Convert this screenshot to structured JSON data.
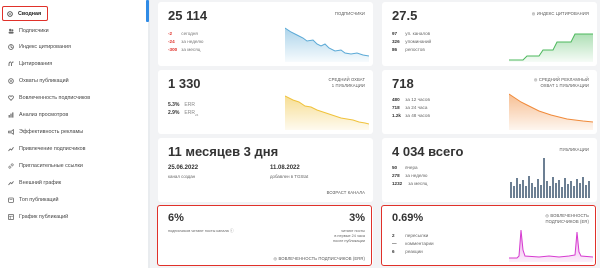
{
  "sidebar": {
    "items": [
      {
        "label": "Сводная",
        "icon": "dashboard-icon"
      },
      {
        "label": "Подписчики",
        "icon": "subscribers-icon"
      },
      {
        "label": "Индекс цитирования",
        "icon": "citation-index-icon"
      },
      {
        "label": "Цитирования",
        "icon": "quotes-icon"
      },
      {
        "label": "Охваты публикаций",
        "icon": "reach-icon"
      },
      {
        "label": "Вовлеченность подписчиков",
        "icon": "engagement-icon"
      },
      {
        "label": "Анализ просмотров",
        "icon": "views-icon"
      },
      {
        "label": "Эффективность рекламы",
        "icon": "ads-icon"
      },
      {
        "label": "Привлечение подписчиков",
        "icon": "growth-icon"
      },
      {
        "label": "Пригласительные ссылки",
        "icon": "link-icon"
      },
      {
        "label": "Внешний график",
        "icon": "external-chart-icon"
      },
      {
        "label": "Топ публикаций",
        "icon": "top-posts-icon"
      },
      {
        "label": "График публикаций",
        "icon": "schedule-icon"
      }
    ]
  },
  "subscribers": {
    "value": "25 114",
    "label": "ПОДПИСЧИКИ",
    "rows": [
      {
        "num": "-2",
        "text": "сегодня"
      },
      {
        "num": "-24",
        "text": "за неделю"
      },
      {
        "num": "-300",
        "text": "за месяц"
      }
    ],
    "color": "#5aa9d6"
  },
  "citation": {
    "value": "27.5",
    "label": "ИНДЕКС ЦИТИРОВАНИЯ",
    "rows": [
      {
        "num": "97",
        "text": "уп. каналов"
      },
      {
        "num": "326",
        "text": "упоминаний"
      },
      {
        "num": "86",
        "text": "репостов"
      }
    ],
    "color": "#4cb85c"
  },
  "reach": {
    "value": "1 330",
    "label_line1": "СРЕДНИЙ ОХВАТ",
    "label_line2": "1 ПУБЛИКАЦИИ",
    "err": "5.3%",
    "err_label": "ERR",
    "err24": "2.9%",
    "err24_label": "ERR",
    "err24_sub": "24",
    "color": "#f0c23b"
  },
  "ad_reach": {
    "value": "718",
    "label_line1": "СРЕДНИЙ РЕКЛАМНЫЙ",
    "label_line2": "ОХВАТ 1 ПУБЛИКАЦИИ",
    "rows": [
      {
        "num": "480",
        "text": "за 12 часов"
      },
      {
        "num": "718",
        "text": "за 24 часа"
      },
      {
        "num": "1.2k",
        "text": "за 48 часов"
      }
    ],
    "color": "#f08a3a"
  },
  "age": {
    "value": "11 месяцев 3 дня",
    "created_date": "25.06.2022",
    "created_label": "канал создан",
    "added_date": "11.08.2022",
    "added_label": "добавлен в TGStat",
    "label": "ВОЗРАСТ КАНАЛА"
  },
  "publications": {
    "value": "4 034 всего",
    "label": "ПУБЛИКАЦИИ",
    "rows": [
      {
        "num": "50",
        "text": "вчера"
      },
      {
        "num": "278",
        "text": "за неделю"
      },
      {
        "num": "1232",
        "text": "за месяц"
      }
    ],
    "color": "#6c7f93"
  },
  "read": {
    "left_value": "6%",
    "left_label": "подписчиков читают посты канала",
    "right_value": "3%",
    "right_line1": "читают посты",
    "right_line2": "в первые 24 часа",
    "right_line3": "после публикации",
    "footer": "ВОВЛЕЧЕННОСТЬ ПОДПИСЧИКОВ (ERR)"
  },
  "er": {
    "value": "0.69%",
    "label_line1": "ВОВЛЕЧЕННОСТЬ",
    "label_line2": "ПОДПИСЧИКОВ (ER)",
    "rows": [
      {
        "num": "2",
        "text": "пересылки"
      },
      {
        "num": "—",
        "text": "комментарии"
      },
      {
        "num": "6",
        "text": "реакции"
      }
    ],
    "color": "#d63bd0"
  }
}
